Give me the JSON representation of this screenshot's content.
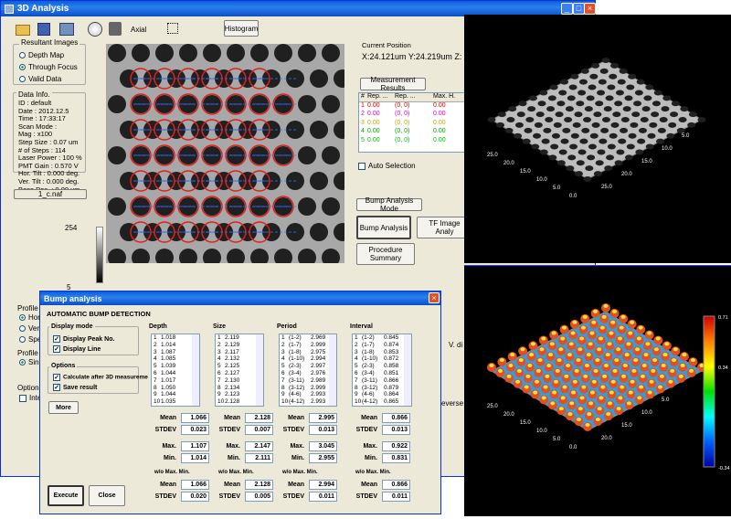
{
  "main_window": {
    "title": "3D Analysis",
    "toolbar": {
      "axial_label": "Axial",
      "histogram_label": "Histogram"
    }
  },
  "resultant_images": {
    "label": "Resultant Images",
    "options": [
      "Depth Map",
      "Through Focus",
      "Valid Data"
    ],
    "selected": 1
  },
  "data_info": {
    "label": "Data Info.",
    "lines": [
      "ID : default",
      "Date : 2012.12.5",
      "Time : 17:33:17",
      "Scan Mode :",
      "Mag : x100",
      "Step Size : 0.07 um",
      "# of Steps : 114",
      "Laser Power : 100 %",
      "PMT Gain : 0.570 V",
      "Hor. Tilt : 0.000 deg.",
      "Ver. Tilt : 0.000 deg.",
      "Base Pos. : 0.00 um"
    ]
  },
  "file_name": "1_c.naf",
  "scale": {
    "max": "254",
    "min": "5"
  },
  "current_position": {
    "label": "Current Position",
    "value": "X:24.121um Y:24.219um Z:"
  },
  "measurement": {
    "button": "Measurement Results",
    "headers": [
      "#",
      "Rep. ...",
      "Rep. ...",
      "Max. H."
    ],
    "rows": [
      [
        "1",
        "0.00",
        "(0, 0)",
        "0.00"
      ],
      [
        "2",
        "0.00",
        "(0, 0)",
        "0.00"
      ],
      [
        "3",
        "0.00",
        "(0, 0)",
        "0.00"
      ],
      [
        "4",
        "0.00",
        "(0, 0)",
        "0.00"
      ],
      [
        "5",
        "0.00",
        "(0, 0)",
        "0.00"
      ]
    ],
    "row_colors": [
      "#d00000",
      "#d000d0",
      "#c8a000",
      "#00a000",
      "#00c000"
    ]
  },
  "auto_selection": "Auto Selection",
  "bump_mode": "Bump Analysis Mode",
  "bump_analysis_btn": "Bump Analysis",
  "tf_image_btn": "TF Image Analy",
  "procedure_btn": "Procedure Summary",
  "side_labels": {
    "profile": "Profile o",
    "horiz": "Horiz",
    "vert": "Verti",
    "spec": "Spec",
    "profile2": "Profile M",
    "single": "Single",
    "option": "Option",
    "inten": "Inten",
    "vdir": "V. di",
    "reverse": "everse"
  },
  "dialog": {
    "title": "Bump analysis",
    "heading": "AUTOMATIC BUMP DETECTION",
    "display_mode": {
      "label": "Display mode",
      "items": [
        "Display Peak No.",
        "Display Line"
      ]
    },
    "options": {
      "label": "Options",
      "items": [
        "Calculate after 3D measureme",
        "Save result"
      ]
    },
    "more": "More",
    "execute": "Execute",
    "close": "Close",
    "row_labels": {
      "mean": "Mean",
      "stdev": "STDEV",
      "max": "Max.",
      "min": "Min.",
      "wo": "w/o Max. Min."
    },
    "columns": [
      {
        "title": "Depth",
        "rows": [
          [
            "1",
            "1.018"
          ],
          [
            "2",
            "1.014"
          ],
          [
            "3",
            "1.087"
          ],
          [
            "4",
            "1.085"
          ],
          [
            "5",
            "1.039"
          ],
          [
            "6",
            "1.044"
          ],
          [
            "7",
            "1.017"
          ],
          [
            "8",
            "1.050"
          ],
          [
            "9",
            "1.044"
          ],
          [
            "10",
            "1.035"
          ]
        ],
        "mean": "1.066",
        "stdev": "0.023",
        "max": "1.107",
        "min": "1.014",
        "wo_mean": "1.066",
        "wo_stdev": "0.020"
      },
      {
        "title": "Size",
        "rows": [
          [
            "1",
            "2.119"
          ],
          [
            "2",
            "2.129"
          ],
          [
            "3",
            "2.117"
          ],
          [
            "4",
            "2.132"
          ],
          [
            "5",
            "2.125"
          ],
          [
            "6",
            "2.127"
          ],
          [
            "7",
            "2.130"
          ],
          [
            "8",
            "2.134"
          ],
          [
            "9",
            "2.123"
          ],
          [
            "10",
            "2.128"
          ]
        ],
        "mean": "2.128",
        "stdev": "0.007",
        "max": "2.147",
        "min": "2.111",
        "wo_mean": "2.128",
        "wo_stdev": "0.005"
      },
      {
        "title": "Period",
        "rows": [
          [
            "1",
            "(1-2)",
            "2.969"
          ],
          [
            "2",
            "(1-7)",
            "2.999"
          ],
          [
            "3",
            "(1-8)",
            "2.975"
          ],
          [
            "4",
            "(1-10)",
            "2.994"
          ],
          [
            "5",
            "(2-3)",
            "2.997"
          ],
          [
            "6",
            "(3-4)",
            "2.976"
          ],
          [
            "7",
            "(3-11)",
            "2.989"
          ],
          [
            "8",
            "(3-12)",
            "2.999"
          ],
          [
            "9",
            "(4-6)",
            "2.993"
          ],
          [
            "10",
            "(4-12)",
            "2.993"
          ]
        ],
        "mean": "2.995",
        "stdev": "0.013",
        "max": "3.045",
        "min": "2.955",
        "wo_mean": "2.994",
        "wo_stdev": "0.011"
      },
      {
        "title": "Interval",
        "rows": [
          [
            "1",
            "(1-2)",
            "0.845"
          ],
          [
            "2",
            "(1-7)",
            "0.874"
          ],
          [
            "3",
            "(1-8)",
            "0.853"
          ],
          [
            "4",
            "(1-10)",
            "0.872"
          ],
          [
            "5",
            "(2-3)",
            "0.858"
          ],
          [
            "6",
            "(3-4)",
            "0.851"
          ],
          [
            "7",
            "(3-11)",
            "0.866"
          ],
          [
            "8",
            "(3-12)",
            "0.879"
          ],
          [
            "9",
            "(4-6)",
            "0.864"
          ],
          [
            "10",
            "(4-12)",
            "0.865"
          ]
        ],
        "mean": "0.866",
        "stdev": "0.013",
        "max": "0.922",
        "min": "0.831",
        "wo_mean": "0.866",
        "wo_stdev": "0.011"
      }
    ]
  },
  "plot_top": {
    "axis_ticks": [
      "25.0",
      "20.0",
      "15.0",
      "10.0",
      "5.0",
      "0.0",
      "25.0",
      "20.0",
      "15.0",
      "10.0",
      "5.0"
    ]
  },
  "plot_bottom": {
    "axis_ticks": [
      "25.0",
      "20.0",
      "15.0",
      "10.0",
      "5.0",
      "0.0",
      "20.0",
      "15.0",
      "10.0",
      "5.0"
    ],
    "colorbar": [
      "0.71",
      "0.34",
      "-0.34"
    ]
  }
}
